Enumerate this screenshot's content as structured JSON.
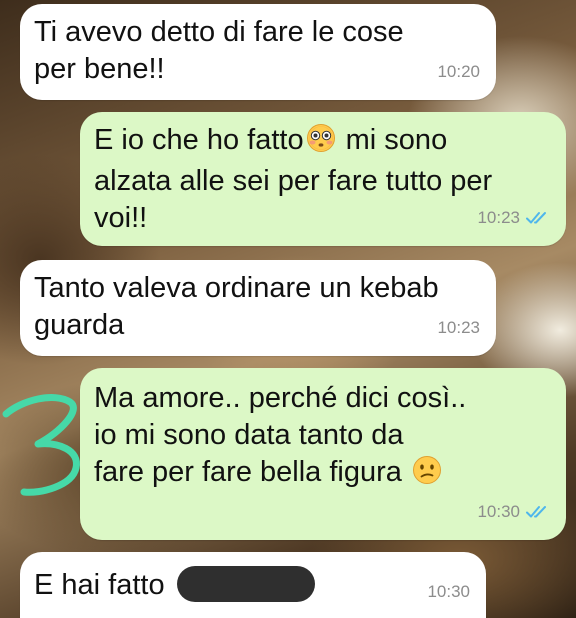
{
  "colors": {
    "incoming_bubble": "#ffffff",
    "outgoing_bubble": "#dcf8c6",
    "read_ticks": "#4fb6ec",
    "scribble": "#46d9a8",
    "redaction": "#2f2f2f"
  },
  "messages": [
    {
      "direction": "incoming",
      "text": "Ti avevo detto di fare le cose\nper bene!!",
      "time": "10:20"
    },
    {
      "direction": "outgoing",
      "text_before_emoji": "E io che ho fatto",
      "emoji": "flushed-face",
      "text_after_emoji": " mi sono\nalzata alle sei per fare tutto per\nvoi!!",
      "time": "10:23",
      "status": "read-double-tick"
    },
    {
      "direction": "incoming",
      "text": "Tanto valeva ordinare un kebab\nguarda",
      "time": "10:23"
    },
    {
      "direction": "outgoing",
      "text": "Ma amore.. perché dici così..\nio mi sono data tanto da\nfare per fare bella figura ",
      "emoji": "confused-face",
      "time": "10:30",
      "status": "read-double-tick"
    },
    {
      "direction": "incoming",
      "text": "E hai fatto ",
      "redacted": true,
      "time": "10:30"
    }
  ],
  "annotation": {
    "text": "3"
  }
}
